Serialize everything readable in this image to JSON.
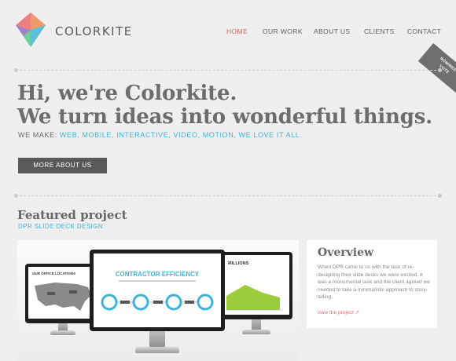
{
  "brand": {
    "name": "COLORKITE",
    "colors": {
      "accent_red": "#e45d5d",
      "accent_blue": "#3fb3d8",
      "text_gray": "#6d6d6d"
    }
  },
  "nav": {
    "items": [
      {
        "label": "HOME",
        "active": true
      },
      {
        "label": "OUR WORK",
        "active": false
      },
      {
        "label": "ABOUT US",
        "active": false
      },
      {
        "label": "CLIENTS",
        "active": false
      },
      {
        "label": "CONTACT",
        "active": false
      }
    ]
  },
  "ribbon": {
    "line1": "NOMINEE",
    "line2": "VOTE"
  },
  "hero": {
    "line1": "Hi, we're Colorkite.",
    "line2": "We turn ideas into wonderful things.",
    "we_make_label": "WE MAKE:",
    "we_make_list": "WEB, MOBILE, INTERACTIVE, VIDEO, MOTION, WE LOVE IT ALL.",
    "cta_label": "MORE ABOUT US"
  },
  "featured": {
    "heading": "Featured project",
    "project_name": "DPR SLIDE DECK DESIGN",
    "slides": {
      "left_title": "OUR OFFICE LOCATIONS",
      "center_title": "CONTRACTOR EFFICIENCY",
      "right_title": "MILLIONS"
    }
  },
  "overview": {
    "title": "Overview",
    "text": "When DPR came to us with the task of re-designing their slide decks we were excited. It was a monumental task and the client agreed we needed to take a minimalistic approach to story-telling.",
    "link": "view the project ↗"
  }
}
